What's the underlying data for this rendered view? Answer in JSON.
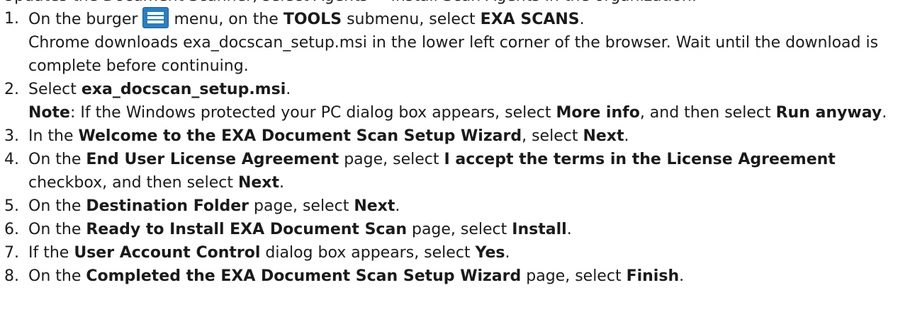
{
  "header_partial": {
    "text": "Updates the Document Scanner, select Agents > Install Scan Agents in the organization:"
  },
  "icons": {
    "burger": "burger-menu-icon",
    "burger_color": "#2a7ec0"
  },
  "steps": [
    {
      "number": "1.",
      "a": "On the burger",
      "b": "menu, on the",
      "c": "TOOLS",
      "d": "submenu, select",
      "e": "EXA SCANS",
      "f": ".",
      "g": "Chrome downloads exa_docscan_setup.msi in the lower left corner of the browser. Wait until the download is complete before continuing."
    },
    {
      "number": "2.",
      "a": "Select",
      "b": "exa_docscan_setup.msi",
      "c": ".",
      "d": "Note",
      "e": ": If the Windows protected your PC dialog box appears, select",
      "f": "More info",
      "g": ", and then select",
      "h": "Run anyway",
      "i": "."
    },
    {
      "number": "3.",
      "a": "In the",
      "b": "Welcome to the EXA Document Scan Setup Wizard",
      "c": ", select",
      "d": "Next",
      "e": "."
    },
    {
      "number": "4.",
      "a": "On the",
      "b": "End User License Agreement",
      "c": "page, select",
      "d": "I accept the terms in the License Agreement",
      "e": "checkbox, and then select",
      "f": "Next",
      "g": "."
    },
    {
      "number": "5.",
      "a": "On the",
      "b": "Destination Folder",
      "c": "page, select",
      "d": "Next",
      "e": "."
    },
    {
      "number": "6.",
      "a": "On the",
      "b": "Ready to Install EXA Document Scan",
      "c": "page, select",
      "d": "Install",
      "e": "."
    },
    {
      "number": "7.",
      "a": "If the",
      "b": "User Account Control",
      "c": "dialog box appears, select",
      "d": "Yes",
      "e": "."
    },
    {
      "number": "8.",
      "a": "On the",
      "b": "Completed the EXA Document Scan Setup Wizard",
      "c": "page, select",
      "d": "Finish",
      "e": "."
    }
  ]
}
